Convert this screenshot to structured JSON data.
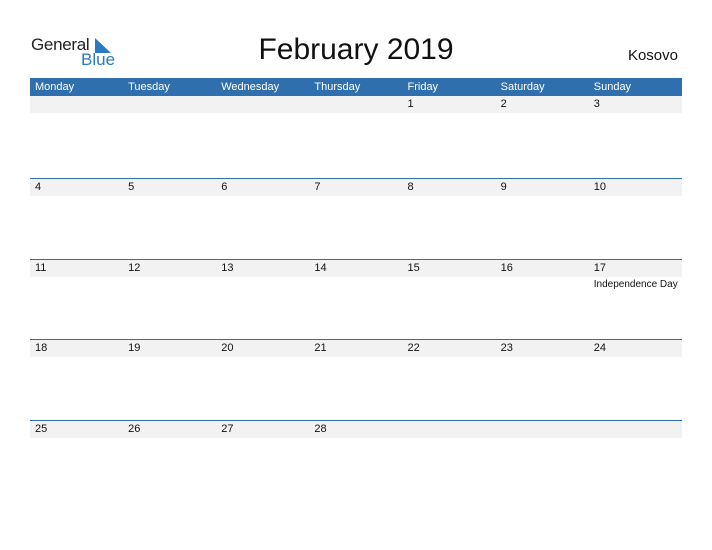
{
  "logo": {
    "general": "General",
    "blue": "Blue"
  },
  "title": "February 2019",
  "country": "Kosovo",
  "accent_color": "#2f6fad",
  "weekdays": [
    "Monday",
    "Tuesday",
    "Wednesday",
    "Thursday",
    "Friday",
    "Saturday",
    "Sunday"
  ],
  "weeks": [
    {
      "days": [
        {
          "date": ""
        },
        {
          "date": ""
        },
        {
          "date": ""
        },
        {
          "date": ""
        },
        {
          "date": "1"
        },
        {
          "date": "2"
        },
        {
          "date": "3"
        }
      ]
    },
    {
      "days": [
        {
          "date": "4"
        },
        {
          "date": "5"
        },
        {
          "date": "6"
        },
        {
          "date": "7"
        },
        {
          "date": "8"
        },
        {
          "date": "9"
        },
        {
          "date": "10"
        }
      ]
    },
    {
      "days": [
        {
          "date": "11"
        },
        {
          "date": "12"
        },
        {
          "date": "13"
        },
        {
          "date": "14"
        },
        {
          "date": "15"
        },
        {
          "date": "16"
        },
        {
          "date": "17",
          "holiday": "Independence Day"
        }
      ]
    },
    {
      "days": [
        {
          "date": "18"
        },
        {
          "date": "19"
        },
        {
          "date": "20"
        },
        {
          "date": "21"
        },
        {
          "date": "22"
        },
        {
          "date": "23"
        },
        {
          "date": "24"
        }
      ]
    },
    {
      "days": [
        {
          "date": "25"
        },
        {
          "date": "26"
        },
        {
          "date": "27"
        },
        {
          "date": "28"
        },
        {
          "date": ""
        },
        {
          "date": ""
        },
        {
          "date": ""
        }
      ]
    }
  ]
}
